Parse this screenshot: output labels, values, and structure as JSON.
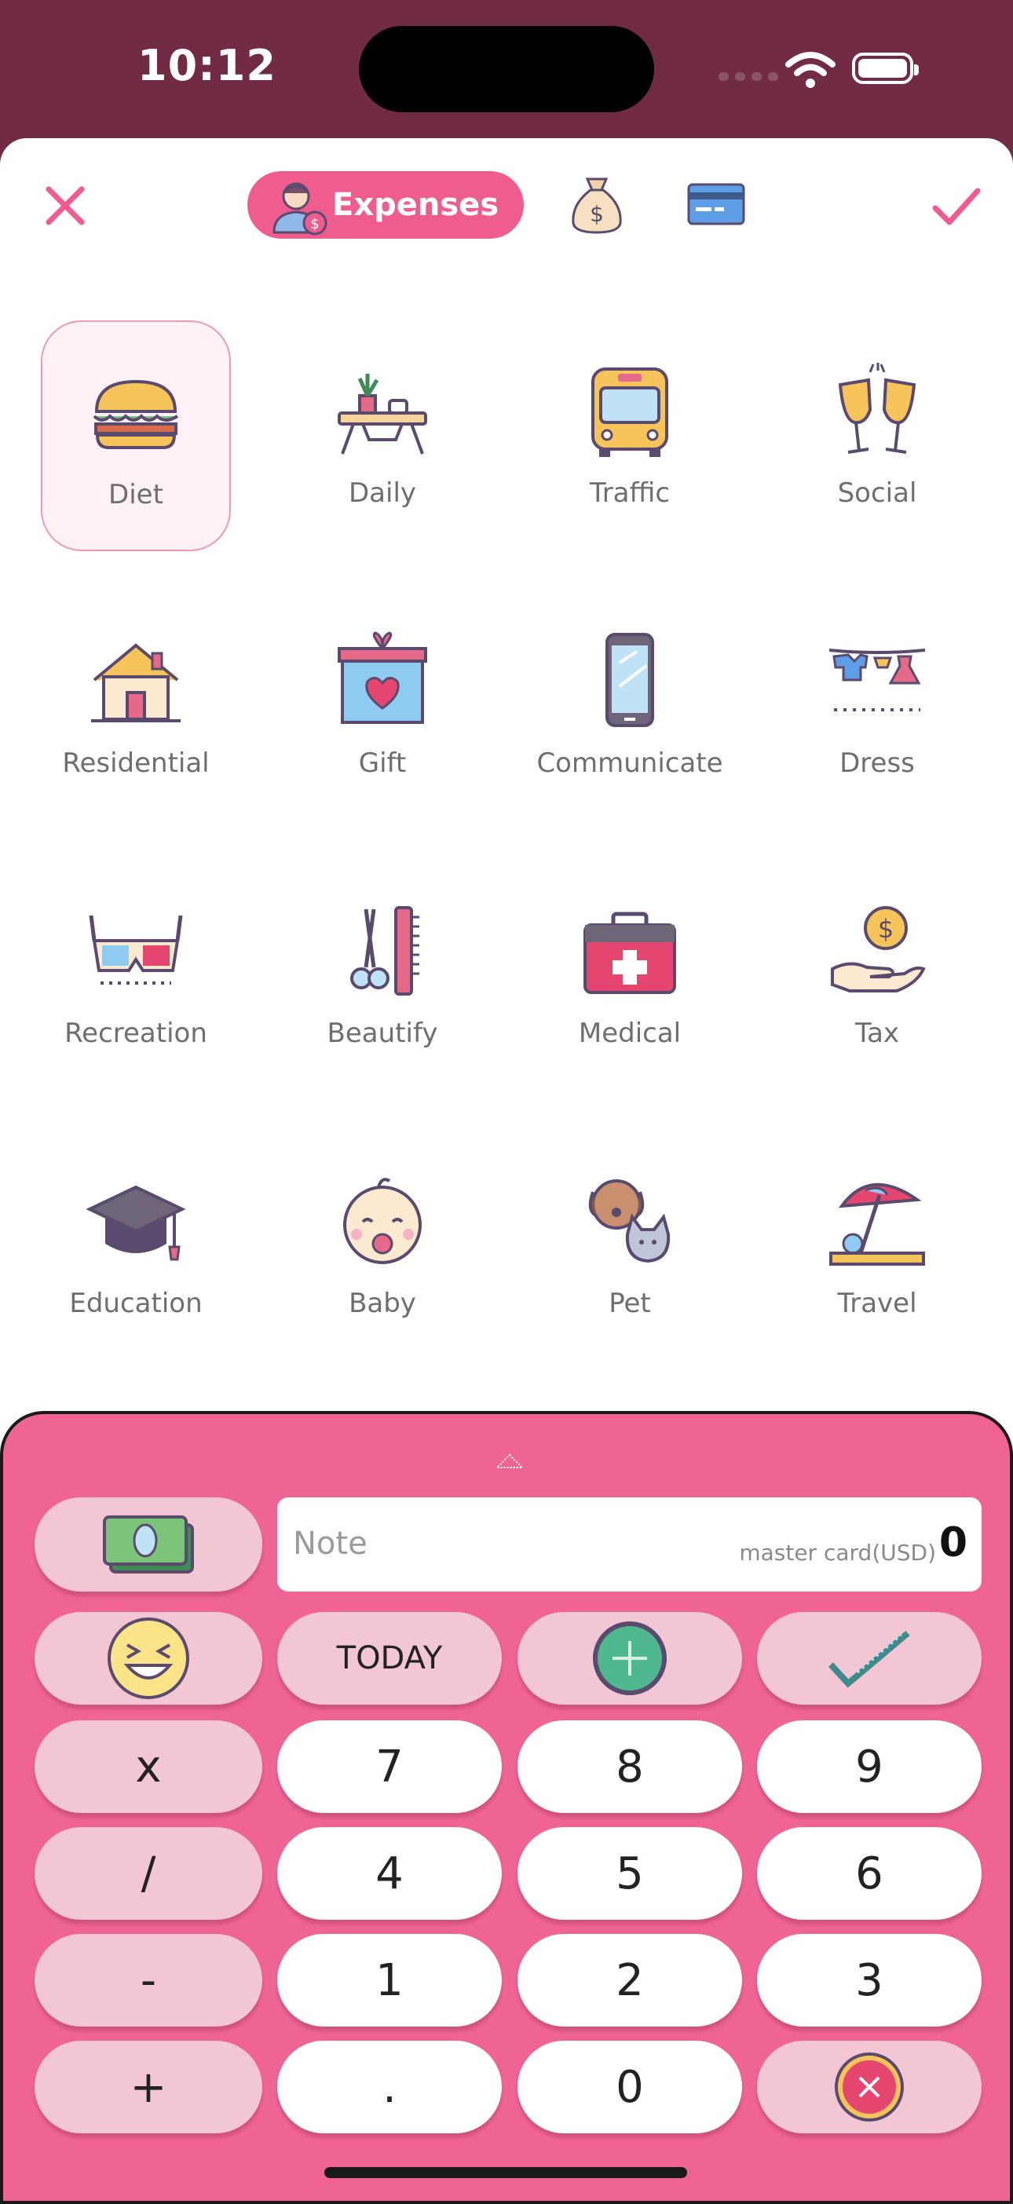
{
  "status_bar": {
    "time": "10:12"
  },
  "header": {
    "close_icon": "close-icon",
    "active_tab": "Expenses",
    "income_tab_icon": "money-bag-icon",
    "account_tab_icon": "credit-card-icon",
    "confirm_icon": "checkmark-icon"
  },
  "categories": [
    {
      "label": "Diet",
      "icon": "burger-icon",
      "selected": true
    },
    {
      "label": "Daily",
      "icon": "table-plant-cup-icon"
    },
    {
      "label": "Traffic",
      "icon": "bus-icon"
    },
    {
      "label": "Social",
      "icon": "toast-glasses-icon"
    },
    {
      "label": "Residential",
      "icon": "house-icon"
    },
    {
      "label": "Gift",
      "icon": "gift-box-icon"
    },
    {
      "label": "Communicate",
      "icon": "phone-icon"
    },
    {
      "label": "Dress",
      "icon": "clothesline-icon"
    },
    {
      "label": "Recreation",
      "icon": "3d-glasses-icon"
    },
    {
      "label": "Beautify",
      "icon": "scissors-comb-icon"
    },
    {
      "label": "Medical",
      "icon": "medical-kit-icon"
    },
    {
      "label": "Tax",
      "icon": "hand-coin-icon"
    },
    {
      "label": "Education",
      "icon": "graduation-cap-icon"
    },
    {
      "label": "Baby",
      "icon": "baby-face-icon"
    },
    {
      "label": "Pet",
      "icon": "dog-cat-icon"
    },
    {
      "label": "Travel",
      "icon": "beach-umbrella-icon"
    }
  ],
  "keypad": {
    "note_placeholder": "Note",
    "account": "master card(USD)",
    "amount": "0",
    "today": "TODAY",
    "ops": [
      "x",
      "/",
      "-",
      "+"
    ],
    "digits": [
      "7",
      "8",
      "9",
      "4",
      "5",
      "6",
      "1",
      "2",
      "3",
      ".",
      "0"
    ]
  },
  "colors": {
    "accent": "#f06494",
    "header_bg": "#722b44",
    "selected_bg": "#fff2f6"
  }
}
